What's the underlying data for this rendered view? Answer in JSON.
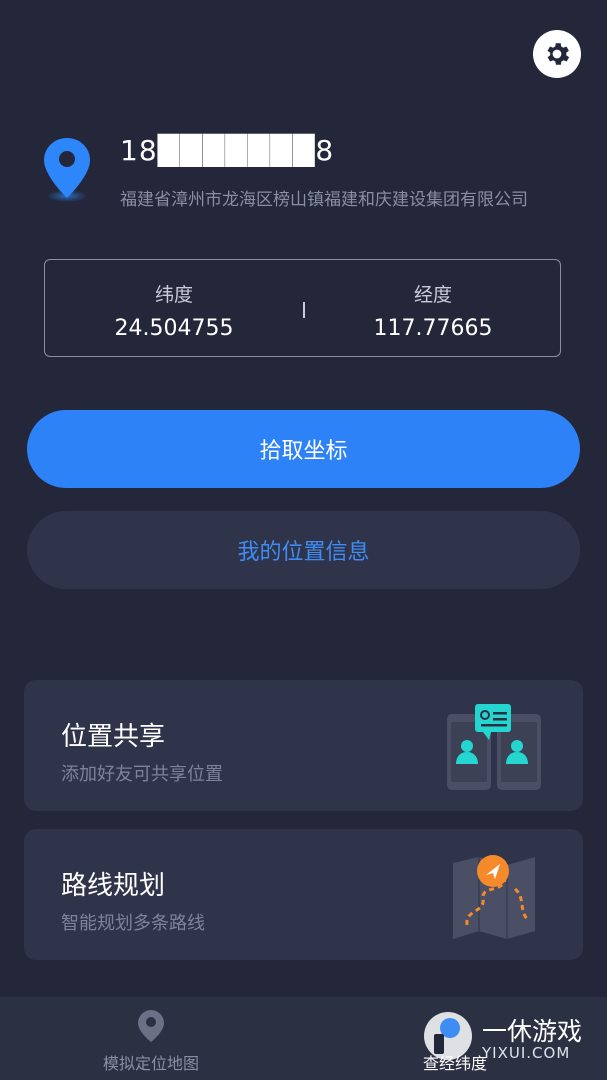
{
  "user": {
    "phone": "18███████8",
    "address": "福建省漳州市龙海区榜山镇福建和庆建设集团有限公司"
  },
  "coords": {
    "latitude_label": "纬度",
    "latitude_value": "24.504755",
    "longitude_label": "经度",
    "longitude_value": "117.77665"
  },
  "actions": {
    "pick_label": "拾取坐标",
    "my_location_label": "我的位置信息"
  },
  "cards": [
    {
      "title": "位置共享",
      "subtitle": "添加好友可共享位置"
    },
    {
      "title": "路线规划",
      "subtitle": "智能规划多条路线"
    }
  ],
  "nav": {
    "items": [
      {
        "label": "模拟定位地图"
      },
      {
        "label": "查经纬度"
      }
    ]
  },
  "watermark": {
    "text": "一休游戏",
    "sub": "YIXUI.COM"
  },
  "colors": {
    "background": "#24273a",
    "primary": "#2e82f8",
    "card": "#30344a",
    "link": "#3d8df5"
  },
  "icons": [
    "gear-icon",
    "location-pin-icon",
    "location-share-icon",
    "route-map-icon",
    "nav-pin-icon"
  ]
}
